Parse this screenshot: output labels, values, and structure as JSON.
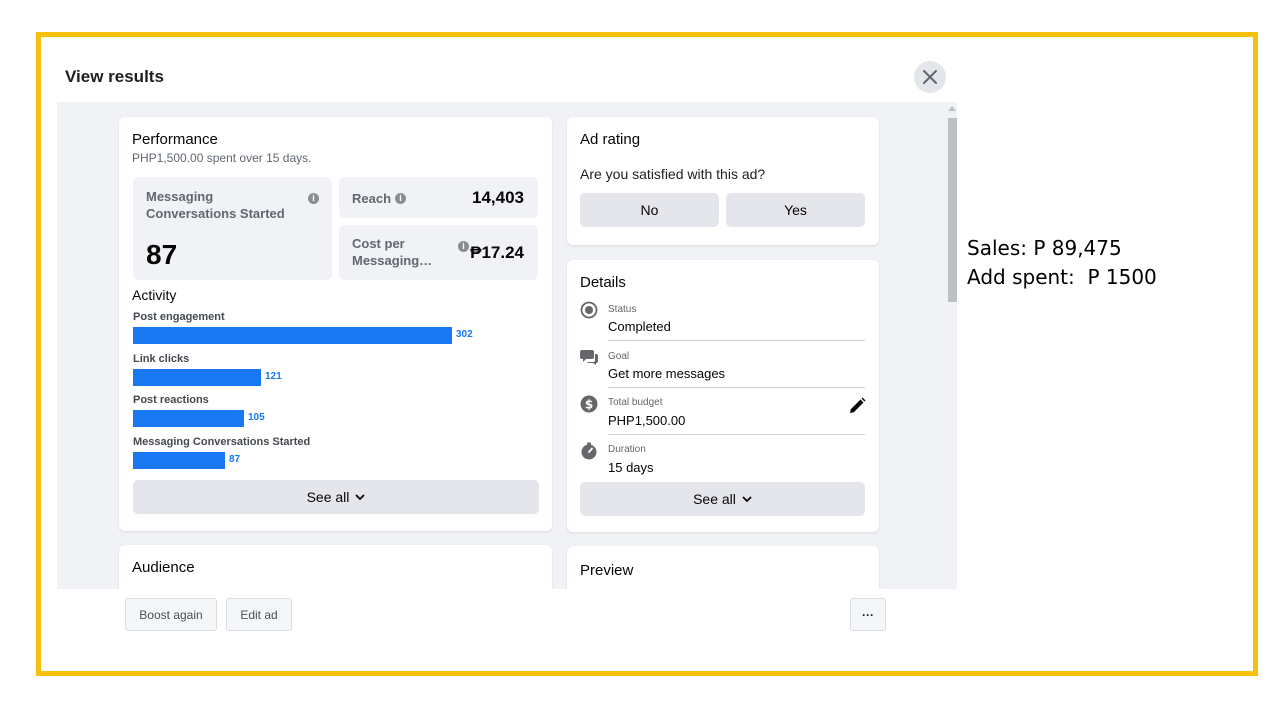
{
  "modal": {
    "title": "View results"
  },
  "performance": {
    "title": "Performance",
    "subtitle_amount": "PHP1,500.00",
    "subtitle_mid": " spent over ",
    "subtitle_days": "15 days.",
    "metrics": {
      "messaging_label": "Messaging Conversations Started",
      "messaging_value": "87",
      "reach_label": "Reach",
      "reach_value": "14,403",
      "cost_label": "Cost per Messaging…",
      "cost_value": "₱17.24"
    },
    "activity_title": "Activity",
    "activity": [
      {
        "label": "Post engagement",
        "value": 302
      },
      {
        "label": "Link clicks",
        "value": 121
      },
      {
        "label": "Post reactions",
        "value": 105
      },
      {
        "label": "Messaging Conversations Started",
        "value": 87
      }
    ],
    "see_all": "See all"
  },
  "ad_rating": {
    "title": "Ad rating",
    "question": "Are you satisfied with this ad?",
    "no": "No",
    "yes": "Yes"
  },
  "details": {
    "title": "Details",
    "status_label": "Status",
    "status_value": "Completed",
    "goal_label": "Goal",
    "goal_value": "Get more messages",
    "budget_label": "Total budget",
    "budget_value": "PHP1,500.00",
    "duration_label": "Duration",
    "duration_value": "15 days",
    "see_all": "See all"
  },
  "audience": {
    "title": "Audience"
  },
  "preview": {
    "title": "Preview"
  },
  "footer": {
    "boost_again": "Boost again",
    "edit_ad": "Edit ad",
    "more": "···"
  },
  "notes": {
    "sales": "Sales: P 89,475",
    "ad_spent": "Add spent:  P 1500"
  },
  "colors": {
    "accent": "#1877f2",
    "frame": "#f8c00e"
  }
}
